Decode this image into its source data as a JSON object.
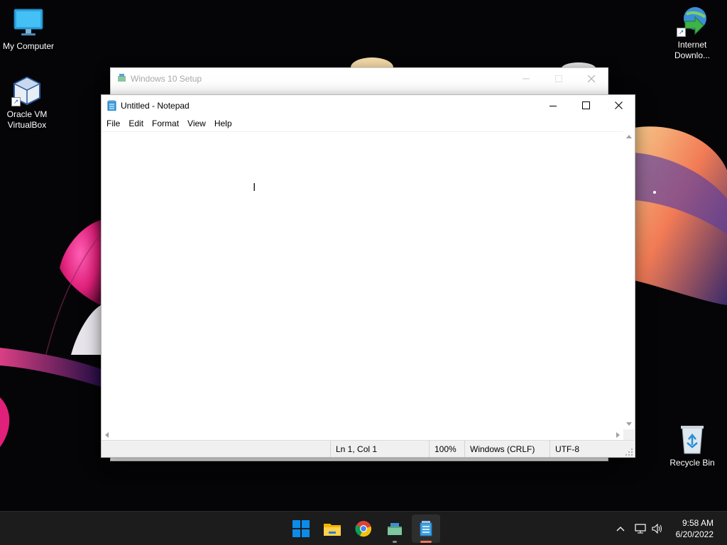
{
  "desktop": {
    "icons": {
      "my_computer": "My Computer",
      "virtualbox": "Oracle VM VirtualBox",
      "internet_download": "Internet Downlo...",
      "recycle_bin": "Recycle Bin"
    }
  },
  "setup_window": {
    "title": "Windows 10 Setup"
  },
  "notepad": {
    "title": "Untitled - Notepad",
    "menu": [
      "File",
      "Edit",
      "Format",
      "View",
      "Help"
    ],
    "content": "",
    "status": {
      "position": "Ln 1, Col 1",
      "zoom": "100%",
      "line_endings": "Windows (CRLF)",
      "encoding": "UTF-8"
    }
  },
  "taskbar": {
    "apps": [
      "start-icon",
      "file-explorer-icon",
      "chrome-icon",
      "setup-icon",
      "notepad-icon"
    ],
    "clock": {
      "time": "9:58 AM",
      "date": "6/20/2022"
    }
  },
  "colors": {
    "accent": "#0078d4",
    "active_indicator": "#f07462"
  }
}
